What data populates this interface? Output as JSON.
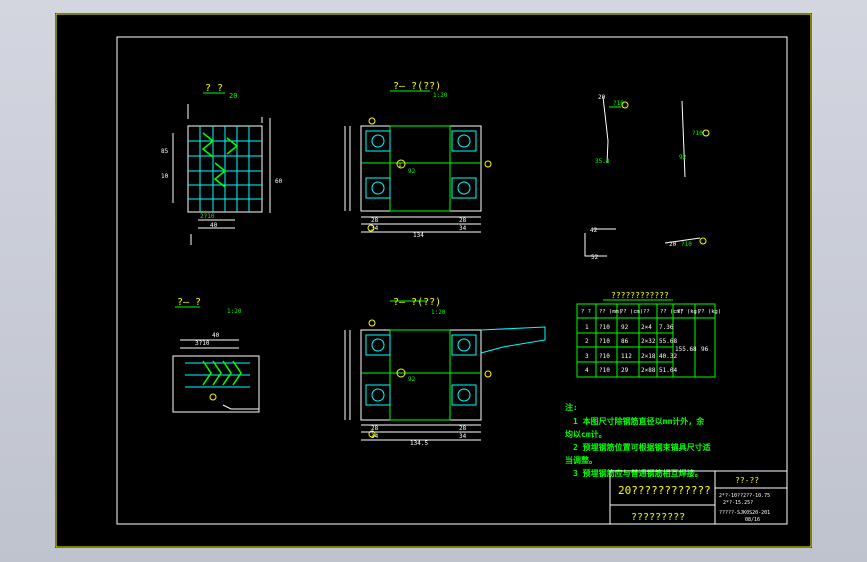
{
  "colors": {
    "background": "#000000",
    "frame": "#ffff00",
    "line_white": "#ffffff",
    "line_cyan": "#00ffff",
    "line_green": "#00ff00",
    "viewport": "#c9ccd6"
  },
  "views": {
    "v1_title": "? ?",
    "v1_scale": "20",
    "v2_title": "?— ?(??)",
    "v2_scale": "1:20",
    "v3_title": "?— ?",
    "v3_scale": "1:20",
    "v4_title": "?— ?(??)",
    "v4_scale": "1:20"
  },
  "dimensions": {
    "v1_w1": "2?10",
    "v1_w2": "40",
    "v1_side_a": "85",
    "v1_side_b": "10",
    "v1_side_c": "60",
    "v2_height": "92",
    "v2_a": "28",
    "v2_b": "34",
    "v2_c": "28",
    "v2_d": "34",
    "v2_total": "134",
    "v3_top": "40",
    "v3_top2": "3?10",
    "v4_height": "92",
    "v4_a": "28",
    "v4_b": "34",
    "v4_c": "28",
    "v4_d": "34",
    "v4_total": "134.5"
  },
  "callouts": {
    "c1": "1",
    "c2": "2",
    "c3": "3",
    "c4": "4"
  },
  "details": {
    "d1_label": "?10",
    "d1_len": "35.8",
    "d1_dim": "20",
    "d2_label": "?10",
    "d2_len": "92",
    "d3_a": "42",
    "d3_b": "52",
    "d4_label": "?10",
    "d4_len": "20"
  },
  "table": {
    "title": "????????????",
    "headers": [
      "? ?",
      "??\n(mm)",
      "??\n(cm)",
      "??",
      "??\n(cm)",
      "??\n(kg)",
      "??\n(kg)"
    ],
    "rows": [
      [
        "1",
        "?10",
        "92",
        "2×4",
        "7.36"
      ],
      [
        "2",
        "?10",
        "86",
        "2×32",
        "55.68"
      ],
      [
        "3",
        "?10",
        "112",
        "2×18",
        "40.32"
      ],
      [
        "4",
        "?10",
        "29",
        "2×88",
        "51.04"
      ]
    ],
    "merged_weight": "155.68",
    "merged_total": "96"
  },
  "notes": {
    "heading": "注:",
    "n1a": "1  本图尺寸除钢筋直径以mm计外，余",
    "n1b": "均以cm计。",
    "n2a": "2  预埋钢筋位置可根据钢束锚具尺寸适",
    "n2b": "当调整。",
    "n3": "3  预埋钢筋应与普通钢筋相互焊接。"
  },
  "title_block": {
    "main_title": "20????????????",
    "sub_title": "?????????",
    "right_top": "??-??",
    "right_l1": "2*?-10??2??-10.75",
    "right_l2": "2*?-15.25?",
    "right_l3": "?????-SJK0S20-201",
    "right_l4": "08/16"
  }
}
